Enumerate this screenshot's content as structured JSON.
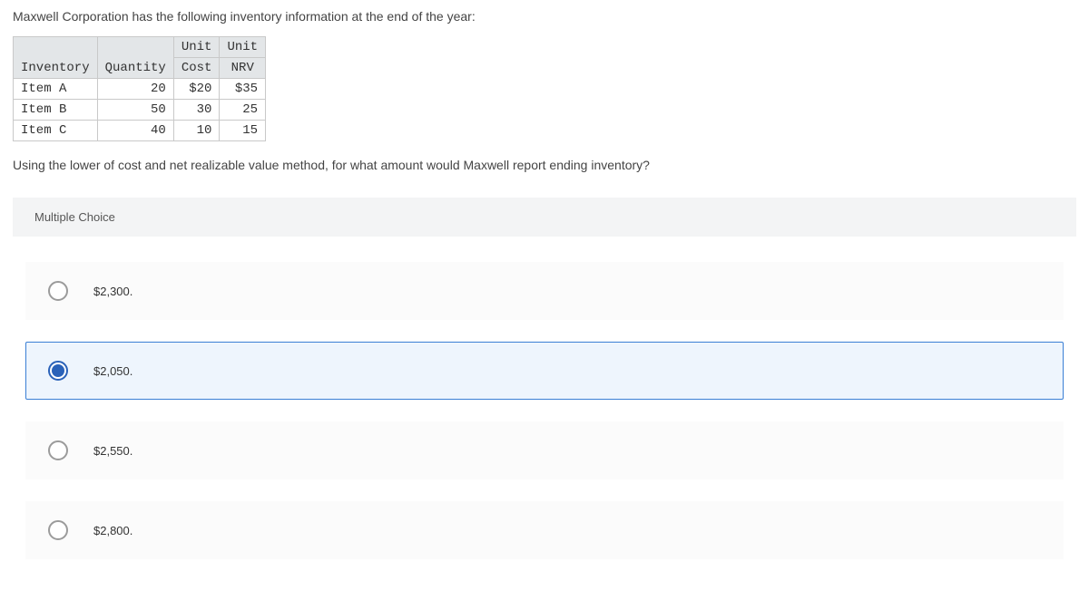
{
  "question_intro": "Maxwell Corporation has the following inventory information at the end of the year:",
  "table": {
    "headers": {
      "inventory": "Inventory",
      "quantity": "Quantity",
      "unit_cost_top": "Unit",
      "unit_cost_bottom": "Cost",
      "unit_nrv_top": "Unit",
      "unit_nrv_bottom": "NRV"
    },
    "rows": [
      {
        "name": "Item A",
        "qty": "20",
        "cost": "$20",
        "nrv": "$35"
      },
      {
        "name": "Item B",
        "qty": "50",
        "cost": "30",
        "nrv": "25"
      },
      {
        "name": "Item C",
        "qty": "40",
        "cost": "10",
        "nrv": "15"
      }
    ]
  },
  "question_followup": "Using the lower of cost and net realizable value method, for what amount would Maxwell report ending inventory?",
  "mc_label": "Multiple Choice",
  "choices": [
    {
      "label": "$2,300.",
      "selected": false
    },
    {
      "label": "$2,050.",
      "selected": true
    },
    {
      "label": "$2,550.",
      "selected": false
    },
    {
      "label": "$2,800.",
      "selected": false
    }
  ]
}
